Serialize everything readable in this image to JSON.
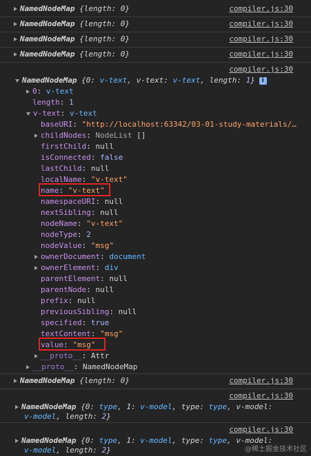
{
  "source_link": "compiler.js:30",
  "collapsed_label": "NamedNodeMap",
  "collapsed_summary": "{length: 0}",
  "expanded": {
    "header_prefix": "NamedNodeMap",
    "header_summary_pre": "{0: ",
    "header_summary_v1": "v-text",
    "header_summary_mid": ", v-text: ",
    "header_summary_v2": "v-text",
    "header_summary_len": ", length: ",
    "header_summary_n": "1",
    "header_summary_end": "}",
    "info_glyph": "i",
    "idx_key": "0",
    "idx_val": "v-text",
    "length_key": "length",
    "length_val": "1",
    "attr_key": "v-text",
    "attr_val": "v-text",
    "props": [
      {
        "k": "baseURI",
        "v": "\"http://localhost:63342/03-01-study-materials/…",
        "t": "str"
      },
      {
        "k": "childNodes",
        "v": "NodeList []",
        "t": "nodelist",
        "expandable": true
      },
      {
        "k": "firstChild",
        "v": "null",
        "t": "val"
      },
      {
        "k": "isConnected",
        "v": "false",
        "t": "num"
      },
      {
        "k": "lastChild",
        "v": "null",
        "t": "val"
      },
      {
        "k": "localName",
        "v": "\"v-text\"",
        "t": "str"
      },
      {
        "k": "name",
        "v": "\"v-text\"",
        "t": "str"
      },
      {
        "k": "namespaceURI",
        "v": "null",
        "t": "val"
      },
      {
        "k": "nextSibling",
        "v": "null",
        "t": "val"
      },
      {
        "k": "nodeName",
        "v": "\"v-text\"",
        "t": "str"
      },
      {
        "k": "nodeType",
        "v": "2",
        "t": "num"
      },
      {
        "k": "nodeValue",
        "v": "\"msg\"",
        "t": "str"
      },
      {
        "k": "ownerDocument",
        "v": "document",
        "t": "blu",
        "expandable": true
      },
      {
        "k": "ownerElement",
        "v": "div",
        "t": "blu",
        "expandable": true
      },
      {
        "k": "parentElement",
        "v": "null",
        "t": "val"
      },
      {
        "k": "parentNode",
        "v": "null",
        "t": "val"
      },
      {
        "k": "prefix",
        "v": "null",
        "t": "val"
      },
      {
        "k": "previousSibling",
        "v": "null",
        "t": "val"
      },
      {
        "k": "specified",
        "v": "true",
        "t": "num"
      },
      {
        "k": "textContent",
        "v": "\"msg\"",
        "t": "str"
      },
      {
        "k": "value",
        "v": "\"msg\"",
        "t": "str"
      }
    ],
    "proto_inner_key": "__proto__",
    "proto_inner_val": "Attr",
    "proto_outer_key": "__proto__",
    "proto_outer_val": "NamedNodeMap"
  },
  "model_rows": {
    "pre": "{0: ",
    "type_a": "type",
    "mid1": ", 1: ",
    "vmodel_a": "v-model",
    "mid2": ", type: ",
    "type_b": "type",
    "mid3": ", v-model:",
    "vmodel_b": "v-model",
    "len": ", length: ",
    "n": "2",
    "end": "}"
  },
  "watermark": "@稀土掘金技术社区"
}
